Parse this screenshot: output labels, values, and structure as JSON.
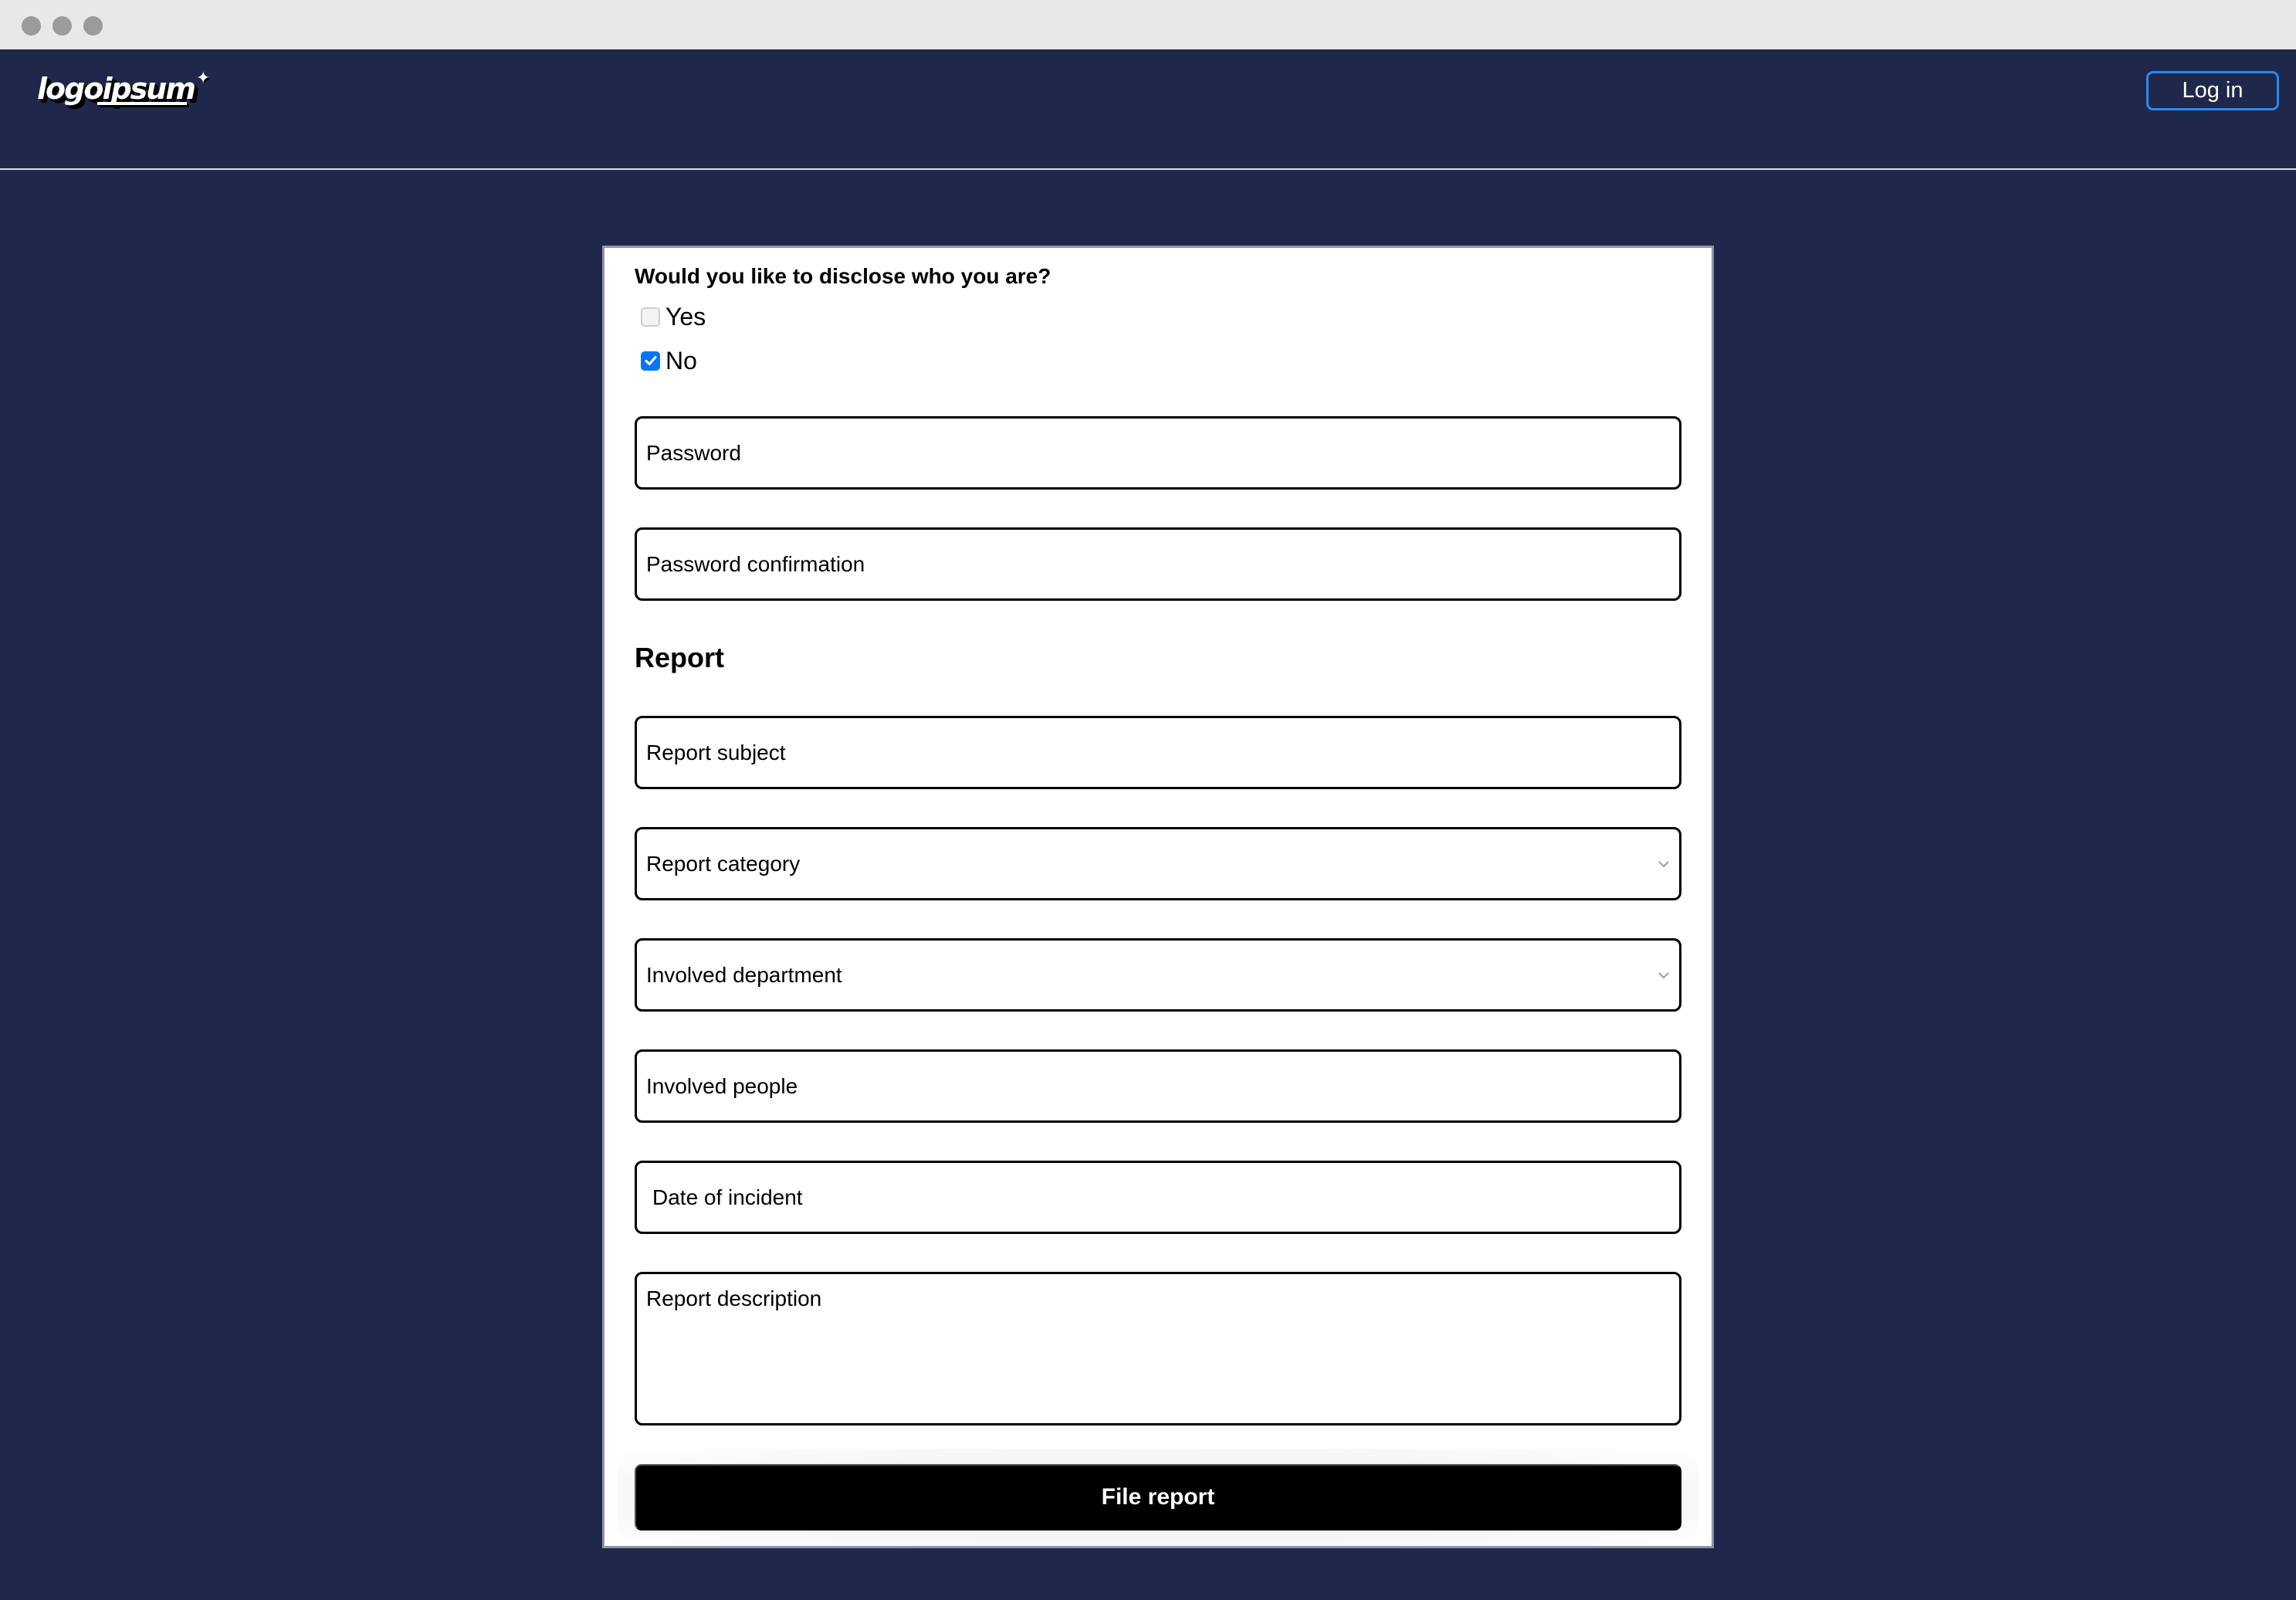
{
  "window": {
    "controls": [
      "close-dot",
      "minimize-dot",
      "maximize-dot"
    ]
  },
  "header": {
    "logo_text": "logoipsum",
    "logo_icon": "sparkle-icon",
    "login_label": "Log in"
  },
  "colors": {
    "background": "#1f284b",
    "login_border": "#2a8af0",
    "checkbox_checked": "#0b74f6",
    "submit_bg": "#000000",
    "card_border": "#9095a6"
  },
  "form": {
    "disclose_question": "Would you like to disclose who you are?",
    "disclose_options": [
      {
        "label": "Yes",
        "checked": false
      },
      {
        "label": "No",
        "checked": true
      }
    ],
    "password": {
      "value": "",
      "placeholder": "Password"
    },
    "password_confirmation": {
      "value": "",
      "placeholder": "Password confirmation"
    },
    "report_section_title": "Report",
    "report_subject": {
      "value": "",
      "placeholder": "Report subject"
    },
    "report_category": {
      "selected": "Report category"
    },
    "involved_department": {
      "selected": "Involved department"
    },
    "involved_people": {
      "value": "",
      "placeholder": "Involved people"
    },
    "date_of_incident": {
      "value": "",
      "placeholder": "Date of incident"
    },
    "report_description": {
      "value": "",
      "placeholder": "Report description"
    },
    "submit_label": "File report"
  }
}
